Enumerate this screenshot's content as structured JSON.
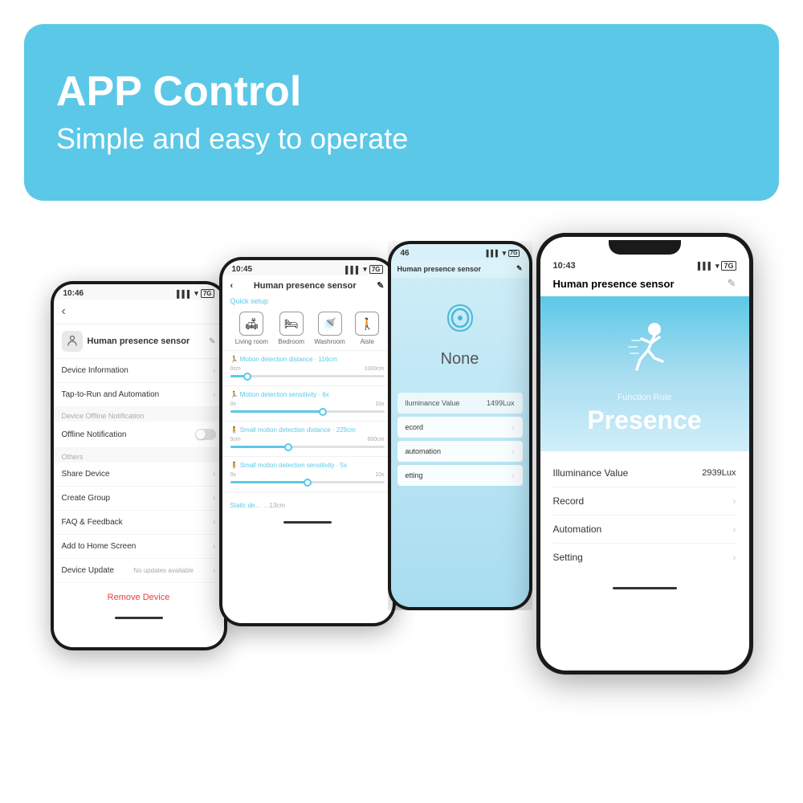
{
  "header": {
    "title": "APP Control",
    "subtitle": "Simple and easy to operate",
    "bg_color": "#5bc8e8"
  },
  "phone1": {
    "status_time": "10:46",
    "nav_back": "‹",
    "device_name": "Human presence sensor",
    "edit_icon": "✎",
    "menu_items": [
      {
        "label": "Device Information",
        "has_arrow": true
      },
      {
        "label": "Tap-to-Run and Automation",
        "has_arrow": true
      }
    ],
    "section_offline": "Device Offline Notification",
    "offline_label": "Offline Notification",
    "section_others": "Others",
    "others_items": [
      {
        "label": "Share Device",
        "has_arrow": true
      },
      {
        "label": "Create Group",
        "has_arrow": true
      },
      {
        "label": "FAQ & Feedback",
        "has_arrow": true
      },
      {
        "label": "Add to Home Screen",
        "has_arrow": true
      },
      {
        "label": "Device Update",
        "value": "No updates available",
        "has_arrow": true
      }
    ],
    "remove_label": "Remove Device"
  },
  "phone2": {
    "status_time": "10:45",
    "title": "Human presence sensor",
    "quick_setup_label": "Quick setup",
    "quick_icons": [
      {
        "icon": "🛋",
        "label": "Living room"
      },
      {
        "icon": "🛏",
        "label": "Bedroom"
      },
      {
        "icon": "🚿",
        "label": "Washroom"
      },
      {
        "icon": "🚶",
        "label": "Aisle"
      }
    ],
    "sliders": [
      {
        "label": "Motion detection distance",
        "value": "116cm",
        "fill_pct": 11,
        "thumb_pct": 11,
        "min": "0cm",
        "max": "1000cm"
      },
      {
        "label": "Motion detection sensitivity",
        "value": "6x",
        "fill_pct": 60,
        "thumb_pct": 60,
        "min": "0x",
        "max": "10x"
      },
      {
        "label": "Small motion detection distance",
        "value": "229cm",
        "fill_pct": 38,
        "thumb_pct": 38,
        "min": "0cm",
        "max": "600cm"
      },
      {
        "label": "Small motion detection sensitivity",
        "value": "5x",
        "fill_pct": 50,
        "thumb_pct": 50,
        "min": "0x",
        "max": "10x"
      }
    ],
    "static_label": "Static de..."
  },
  "phone3": {
    "status_time": "46",
    "title": "Human presence sensor",
    "status": "None",
    "illuminance_label": "lluminance Value",
    "illuminance_value": "1499Lux",
    "record_label": "ecord",
    "automation_label": "automation",
    "setting_label": "etting"
  },
  "phone4": {
    "status_time": "10:43",
    "title": "Human presence sensor",
    "function_rule": "Function Rule",
    "presence_text": "Presence",
    "illuminance_label": "Illuminance Value",
    "illuminance_value": "2939Lux",
    "record_label": "Record",
    "automation_label": "Automation",
    "setting_label": "Setting"
  }
}
